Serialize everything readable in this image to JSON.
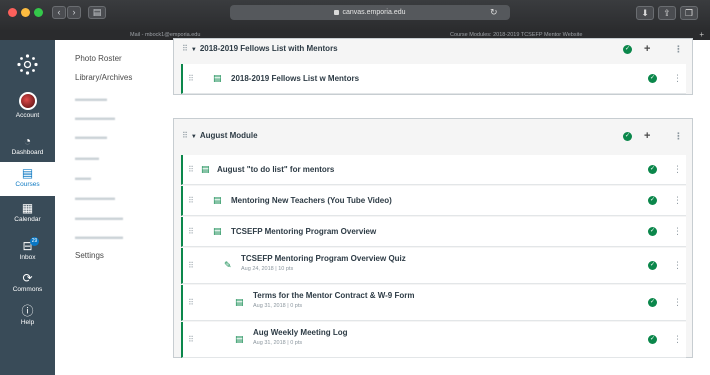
{
  "browser": {
    "url": "canvas.emporia.edu",
    "tab_left": "Mail - mbock1@emporia.edu",
    "tab_right": "Course Modules: 2018-2019 TCSEFP Mentor Website",
    "new_tab": "+",
    "back": "‹",
    "forward": "›",
    "sidebar_btn": "▤",
    "reload": "↻",
    "download": "⬇",
    "share": "⇪",
    "tabs_btn": "❐"
  },
  "global_nav": {
    "items": [
      {
        "label": "Account",
        "icon": "avatar-icon"
      },
      {
        "label": "Dashboard",
        "icon": "dashboard-icon"
      },
      {
        "label": "Courses",
        "icon": "courses-icon"
      },
      {
        "label": "Calendar",
        "icon": "calendar-icon"
      },
      {
        "label": "Inbox",
        "icon": "inbox-icon",
        "badge": "29"
      },
      {
        "label": "Commons",
        "icon": "commons-icon"
      },
      {
        "label": "Help",
        "icon": "help-icon"
      }
    ]
  },
  "course_nav": {
    "items": [
      "Photo Roster",
      "Library/Archives",
      "Settings"
    ],
    "faded_count": 8
  },
  "modules": [
    {
      "title": "2018-2019 Fellows List with Mentors",
      "items": [
        {
          "title": "2018-2019 Fellows List w Mentors",
          "meta": ""
        }
      ]
    },
    {
      "title": "August Module",
      "items": [
        {
          "title": "August \"to do list\" for mentors",
          "meta": ""
        },
        {
          "title": "Mentoring New Teachers (You Tube Video)",
          "meta": ""
        },
        {
          "title": "TCSEFP Mentoring Program Overview",
          "meta": ""
        },
        {
          "title": "TCSEFP Mentoring Program Overview Quiz",
          "meta": "Aug 24, 2018 | 10 pts"
        },
        {
          "title": "Terms for the Mentor Contract & W-9 Form",
          "meta": "Aug 31, 2018 | 0 pts"
        },
        {
          "title": "Aug Weekly Meeting Log",
          "meta": "Aug 31, 2018 | 0 pts"
        }
      ]
    }
  ],
  "colors": {
    "global_nav_bg": "#394b58",
    "accent": "#0f7ac3",
    "published": "#0b874b"
  }
}
